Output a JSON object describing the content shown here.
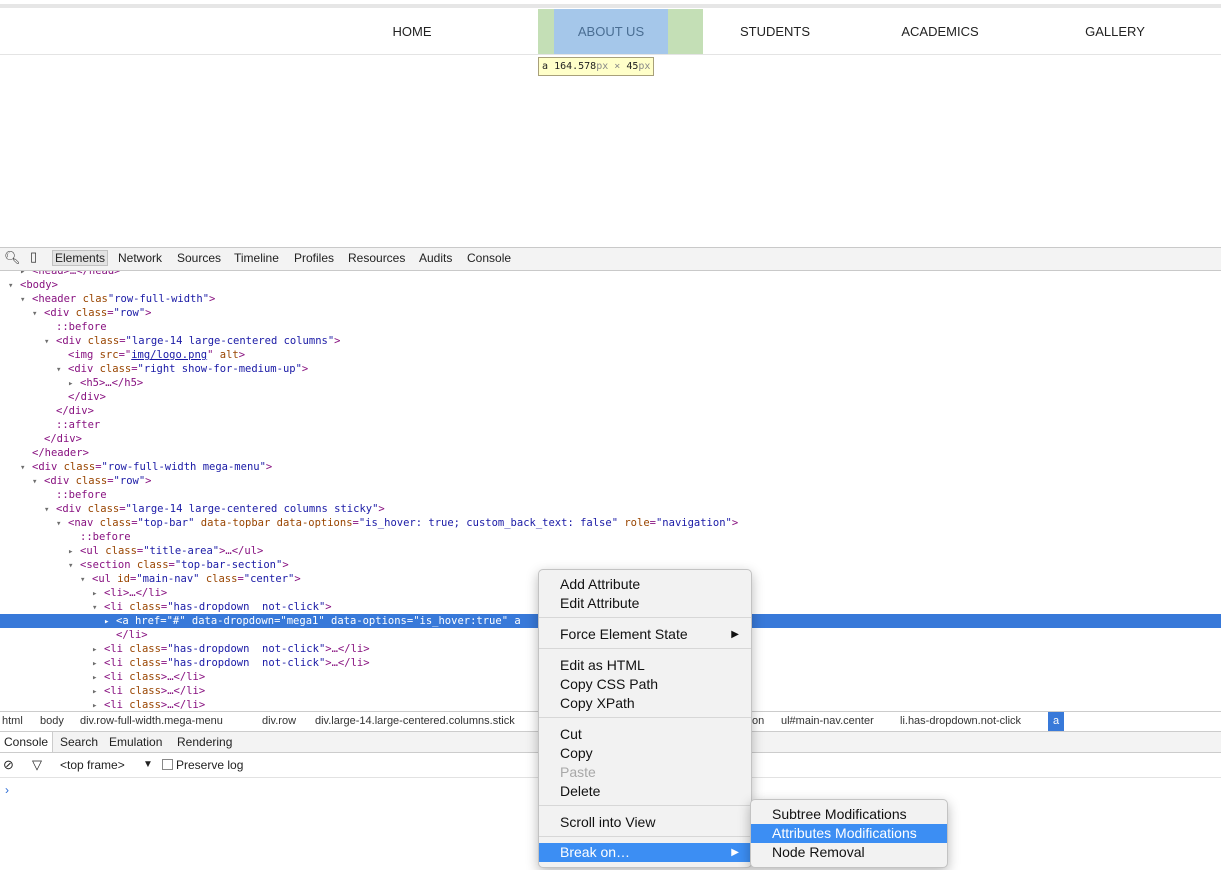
{
  "page": {
    "nav": [
      {
        "label": "HOME"
      },
      {
        "label": "ABOUT US"
      },
      {
        "label": "STUDENTS"
      },
      {
        "label": "ACADEMICS"
      },
      {
        "label": "GALLERY"
      }
    ],
    "tooltip": {
      "tag": "a",
      "width": "164.578",
      "x": "×",
      "height": "45",
      "unit": "px"
    }
  },
  "devtools": {
    "tabs": [
      "Elements",
      "Network",
      "Sources",
      "Timeline",
      "Profiles",
      "Resources",
      "Audits",
      "Console"
    ],
    "breadcrumbs": [
      "html",
      "body",
      "div.row-full-width.mega-menu",
      "div.row",
      "div.large-14.large-centered.columns.stick",
      "on",
      "ul#main-nav.center",
      "li.has-dropdown.not-click",
      "a"
    ],
    "console_tabs": [
      "Console",
      "Search",
      "Emulation",
      "Rendering"
    ],
    "console_bar": {
      "frame": "<top frame>",
      "preserve": "Preserve log"
    },
    "prompt": "›",
    "colors": {
      "selection": "#3879d9",
      "menu_highlight": "#3c8ef3",
      "tag": "#881280",
      "attr_name": "#994500",
      "attr_value": "#1a1aa6"
    }
  },
  "tree": [
    {
      "indent": 1,
      "tri": "▸",
      "parts": [
        [
          "tn",
          "<head>…</head>"
        ]
      ]
    },
    {
      "indent": 0,
      "tri": "▾",
      "parts": [
        [
          "tn",
          "<body>"
        ]
      ]
    },
    {
      "indent": 1,
      "tri": "▾",
      "parts": [
        [
          "tn",
          "<header "
        ],
        [
          "an",
          "clas"
        ],
        [
          "av",
          "\"row-full-width\""
        ],
        [
          "tn",
          ">"
        ]
      ]
    },
    {
      "indent": 2,
      "tri": "▾",
      "parts": [
        [
          "tn",
          "<div "
        ],
        [
          "an",
          "class"
        ],
        [
          "tn",
          "="
        ],
        [
          "av",
          "\"row\""
        ],
        [
          "tn",
          ">"
        ]
      ]
    },
    {
      "indent": 3,
      "tri": "",
      "parts": [
        [
          "pseudo",
          "::before"
        ]
      ]
    },
    {
      "indent": 3,
      "tri": "▾",
      "parts": [
        [
          "tn",
          "<div "
        ],
        [
          "an",
          "class"
        ],
        [
          "tn",
          "="
        ],
        [
          "av",
          "\"large-14 large-centered columns\""
        ],
        [
          "tn",
          ">"
        ]
      ]
    },
    {
      "indent": 4,
      "tri": "",
      "parts": [
        [
          "tn",
          "<img "
        ],
        [
          "an",
          "src"
        ],
        [
          "tn",
          "=\""
        ],
        [
          "avu",
          "img/logo.png"
        ],
        [
          "tn",
          "\" "
        ],
        [
          "an",
          "alt"
        ],
        [
          "tn",
          ">"
        ]
      ]
    },
    {
      "indent": 4,
      "tri": "▾",
      "parts": [
        [
          "tn",
          "<div "
        ],
        [
          "an",
          "class"
        ],
        [
          "tn",
          "="
        ],
        [
          "av",
          "\"right show-for-medium-up\""
        ],
        [
          "tn",
          ">"
        ]
      ]
    },
    {
      "indent": 5,
      "tri": "▸",
      "parts": [
        [
          "tn",
          "<h5>…</h5>"
        ]
      ]
    },
    {
      "indent": 4,
      "tri": "",
      "parts": [
        [
          "tn",
          "</div>"
        ]
      ]
    },
    {
      "indent": 3,
      "tri": "",
      "parts": [
        [
          "tn",
          "</div>"
        ]
      ]
    },
    {
      "indent": 3,
      "tri": "",
      "parts": [
        [
          "pseudo",
          "::after"
        ]
      ]
    },
    {
      "indent": 2,
      "tri": "",
      "parts": [
        [
          "tn",
          "</div>"
        ]
      ]
    },
    {
      "indent": 1,
      "tri": "",
      "parts": [
        [
          "tn",
          "</header>"
        ]
      ]
    },
    {
      "indent": 1,
      "tri": "▾",
      "parts": [
        [
          "tn",
          "<div "
        ],
        [
          "an",
          "class"
        ],
        [
          "tn",
          "="
        ],
        [
          "av",
          "\"row-full-width mega-menu\""
        ],
        [
          "tn",
          ">"
        ]
      ]
    },
    {
      "indent": 2,
      "tri": "▾",
      "parts": [
        [
          "tn",
          "<div "
        ],
        [
          "an",
          "class"
        ],
        [
          "tn",
          "="
        ],
        [
          "av",
          "\"row\""
        ],
        [
          "tn",
          ">"
        ]
      ]
    },
    {
      "indent": 3,
      "tri": "",
      "parts": [
        [
          "pseudo",
          "::before"
        ]
      ]
    },
    {
      "indent": 3,
      "tri": "▾",
      "parts": [
        [
          "tn",
          "<div "
        ],
        [
          "an",
          "class"
        ],
        [
          "tn",
          "="
        ],
        [
          "av",
          "\"large-14 large-centered columns sticky\""
        ],
        [
          "tn",
          ">"
        ]
      ]
    },
    {
      "indent": 4,
      "tri": "▾",
      "parts": [
        [
          "tn",
          "<nav "
        ],
        [
          "an",
          "class"
        ],
        [
          "tn",
          "="
        ],
        [
          "av",
          "\"top-bar\""
        ],
        [
          "tn",
          " "
        ],
        [
          "an",
          "data-topbar"
        ],
        [
          "tn",
          " "
        ],
        [
          "an",
          "data-options"
        ],
        [
          "tn",
          "="
        ],
        [
          "av",
          "\"is_hover: true; custom_back_text: false\""
        ],
        [
          "tn",
          " "
        ],
        [
          "an",
          "role"
        ],
        [
          "tn",
          "="
        ],
        [
          "av",
          "\"navigation\""
        ],
        [
          "tn",
          ">"
        ]
      ]
    },
    {
      "indent": 5,
      "tri": "",
      "parts": [
        [
          "pseudo",
          "::before"
        ]
      ]
    },
    {
      "indent": 5,
      "tri": "▸",
      "parts": [
        [
          "tn",
          "<ul "
        ],
        [
          "an",
          "class"
        ],
        [
          "tn",
          "="
        ],
        [
          "av",
          "\"title-area\""
        ],
        [
          "tn",
          ">…</ul>"
        ]
      ]
    },
    {
      "indent": 5,
      "tri": "▾",
      "parts": [
        [
          "tn",
          "<section "
        ],
        [
          "an",
          "class"
        ],
        [
          "tn",
          "="
        ],
        [
          "av",
          "\"top-bar-section\""
        ],
        [
          "tn",
          ">"
        ]
      ]
    },
    {
      "indent": 6,
      "tri": "▾",
      "parts": [
        [
          "tn",
          "<ul "
        ],
        [
          "an",
          "id"
        ],
        [
          "tn",
          "="
        ],
        [
          "av",
          "\"main-nav\""
        ],
        [
          "tn",
          " "
        ],
        [
          "an",
          "class"
        ],
        [
          "tn",
          "="
        ],
        [
          "av",
          "\"center\""
        ],
        [
          "tn",
          ">"
        ]
      ]
    },
    {
      "indent": 7,
      "tri": "▸",
      "parts": [
        [
          "tn",
          "<li>…</li>"
        ]
      ]
    },
    {
      "indent": 7,
      "tri": "▾",
      "parts": [
        [
          "tn",
          "<li "
        ],
        [
          "an",
          "class"
        ],
        [
          "tn",
          "="
        ],
        [
          "av",
          "\"has-dropdown  not-click\""
        ],
        [
          "tn",
          ">"
        ]
      ]
    },
    {
      "indent": 8,
      "tri": "▸",
      "sel": true,
      "parts": [
        [
          "tn",
          "<a "
        ],
        [
          "an",
          "href"
        ],
        [
          "tn",
          "="
        ],
        [
          "av",
          "\"#\""
        ],
        [
          "tn",
          " "
        ],
        [
          "an",
          "data-dropdown"
        ],
        [
          "tn",
          "="
        ],
        [
          "av",
          "\"mega1\""
        ],
        [
          "tn",
          " "
        ],
        [
          "an",
          "data-options"
        ],
        [
          "tn",
          "="
        ],
        [
          "av",
          "\"is_hover:true\""
        ],
        [
          "tn",
          " a"
        ]
      ]
    },
    {
      "indent": 8,
      "tri": "",
      "parts": [
        [
          "tn",
          "</li>"
        ]
      ]
    },
    {
      "indent": 7,
      "tri": "▸",
      "parts": [
        [
          "tn",
          "<li "
        ],
        [
          "an",
          "class"
        ],
        [
          "tn",
          "="
        ],
        [
          "av",
          "\"has-dropdown  not-click\""
        ],
        [
          "tn",
          ">…</li>"
        ]
      ]
    },
    {
      "indent": 7,
      "tri": "▸",
      "parts": [
        [
          "tn",
          "<li "
        ],
        [
          "an",
          "class"
        ],
        [
          "tn",
          "="
        ],
        [
          "av",
          "\"has-dropdown  not-click\""
        ],
        [
          "tn",
          ">…</li>"
        ]
      ]
    },
    {
      "indent": 7,
      "tri": "▸",
      "parts": [
        [
          "tn",
          "<li "
        ],
        [
          "an",
          "class"
        ],
        [
          "tn",
          ">…</li>"
        ]
      ]
    },
    {
      "indent": 7,
      "tri": "▸",
      "parts": [
        [
          "tn",
          "<li "
        ],
        [
          "an",
          "class"
        ],
        [
          "tn",
          ">…</li>"
        ]
      ]
    },
    {
      "indent": 7,
      "tri": "▸",
      "parts": [
        [
          "tn",
          "<li "
        ],
        [
          "an",
          "class"
        ],
        [
          "tn",
          ">…</li>"
        ]
      ]
    }
  ],
  "context_menu": {
    "items": [
      {
        "label": "Add Attribute"
      },
      {
        "label": "Edit Attribute"
      },
      {
        "label": "Force Element State",
        "submenu": true
      },
      {
        "label": "Edit as HTML"
      },
      {
        "label": "Copy CSS Path"
      },
      {
        "label": "Copy XPath"
      },
      {
        "label": "Cut"
      },
      {
        "label": "Copy"
      },
      {
        "label": "Paste",
        "disabled": true
      },
      {
        "label": "Delete"
      },
      {
        "label": "Scroll into View"
      },
      {
        "label": "Break on…",
        "submenu": true,
        "highlighted": true
      }
    ],
    "submenu": [
      {
        "label": "Subtree Modifications"
      },
      {
        "label": "Attributes Modifications",
        "highlighted": true
      },
      {
        "label": "Node Removal"
      }
    ],
    "arrow": "▶"
  }
}
